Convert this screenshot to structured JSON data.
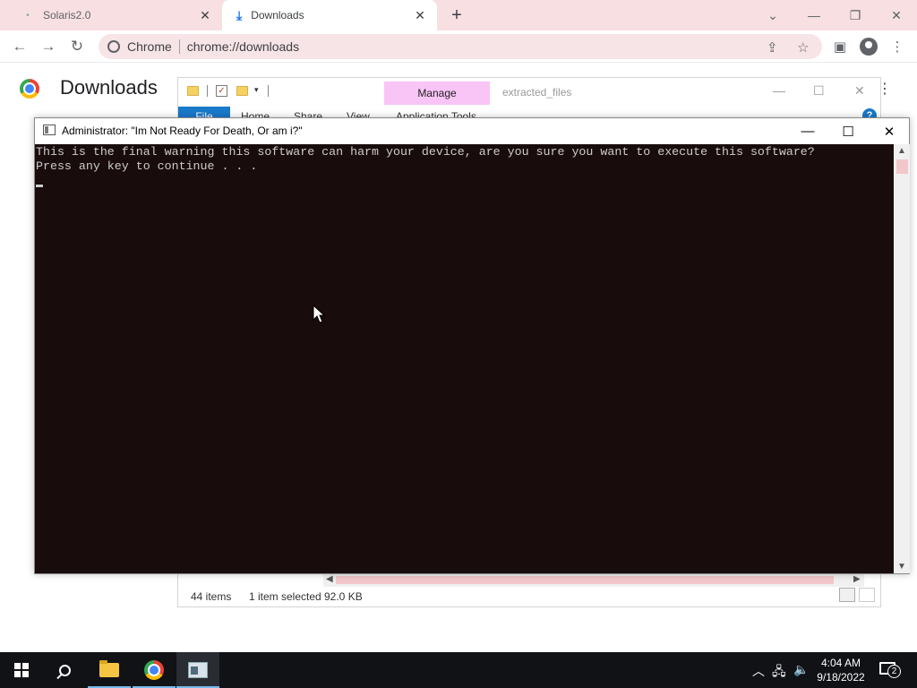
{
  "browser": {
    "tabs": [
      {
        "title": "Solaris2.0",
        "favicon": "loading-dot-icon",
        "active": false
      },
      {
        "title": "Downloads",
        "favicon": "download-icon",
        "active": true
      }
    ],
    "close_glyph": "✕",
    "new_tab_glyph": "+",
    "omnibox": {
      "site": "Chrome",
      "url": "chrome://downloads"
    }
  },
  "downloads_page": {
    "title": "Downloads"
  },
  "explorer": {
    "manage_tab": "Manage",
    "window_title": "extracted_files",
    "ribbon_tabs": [
      "File",
      "Home",
      "Share",
      "View",
      "Application Tools"
    ],
    "status": {
      "items": "44 items",
      "selected": "1 item selected",
      "size": "92.0 KB"
    }
  },
  "console": {
    "title": "Administrator:  \"Im Not Ready For Death, Or am i?\"",
    "lines": [
      "This is the final warning this software can harm your device, are you sure you want to execute this software?",
      "Press any key to continue . . ."
    ],
    "background": "#190c0c",
    "text_color": "#cccccc"
  },
  "taskbar": {
    "apps": [
      "start-icon",
      "search-icon",
      "file-explorer-icon",
      "chrome-icon",
      "console-icon"
    ],
    "clock": {
      "time": "4:04 AM",
      "date": "9/18/2022"
    },
    "notification_count": "2"
  }
}
